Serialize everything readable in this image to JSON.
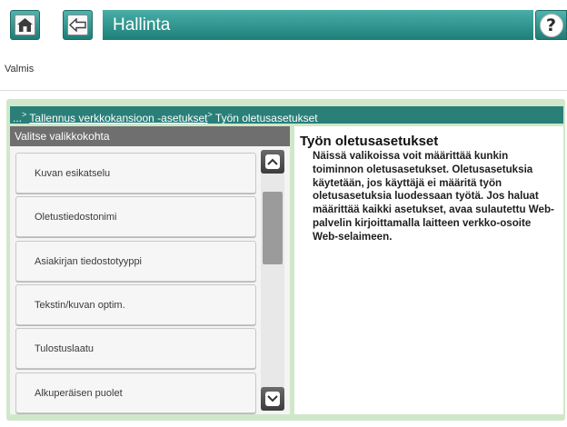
{
  "header": {
    "title": "Hallinta",
    "help_glyph": "?",
    "accent_color": "#2a8a83"
  },
  "status": {
    "text": "Valmis"
  },
  "breadcrumb": {
    "prefix": "...",
    "sep": ">",
    "link": "Tallennus verkkokansioon -asetukset",
    "current": "Työn oletusasetukset"
  },
  "menu": {
    "header": "Valitse valikkokohta",
    "items": [
      "Kuvan esikatselu",
      "Oletustiedostonimi",
      "Asiakirjan tiedostotyyppi",
      "Tekstin/kuvan optim.",
      "Tulostuslaatu",
      "Alkuperäisen puolet"
    ]
  },
  "info": {
    "title": "Työn oletusasetukset",
    "body": "Näissä valikoissa voit määrittää kunkin toiminnon oletusasetukset. Oletusasetuksia käytetään, jos käyttäjä ei määritä työn oletusasetuksia luodessaan työtä. Jos haluat määrittää kaikki asetukset, avaa sulautettu Web-palvelin kirjoittamalla laitteen verkko-osoite Web-selaimeen."
  },
  "icons": {
    "home": "home-icon",
    "back": "back-arrow-icon",
    "help": "help-icon",
    "scroll_up": "chevron-up-icon",
    "scroll_down": "chevron-down-icon"
  }
}
